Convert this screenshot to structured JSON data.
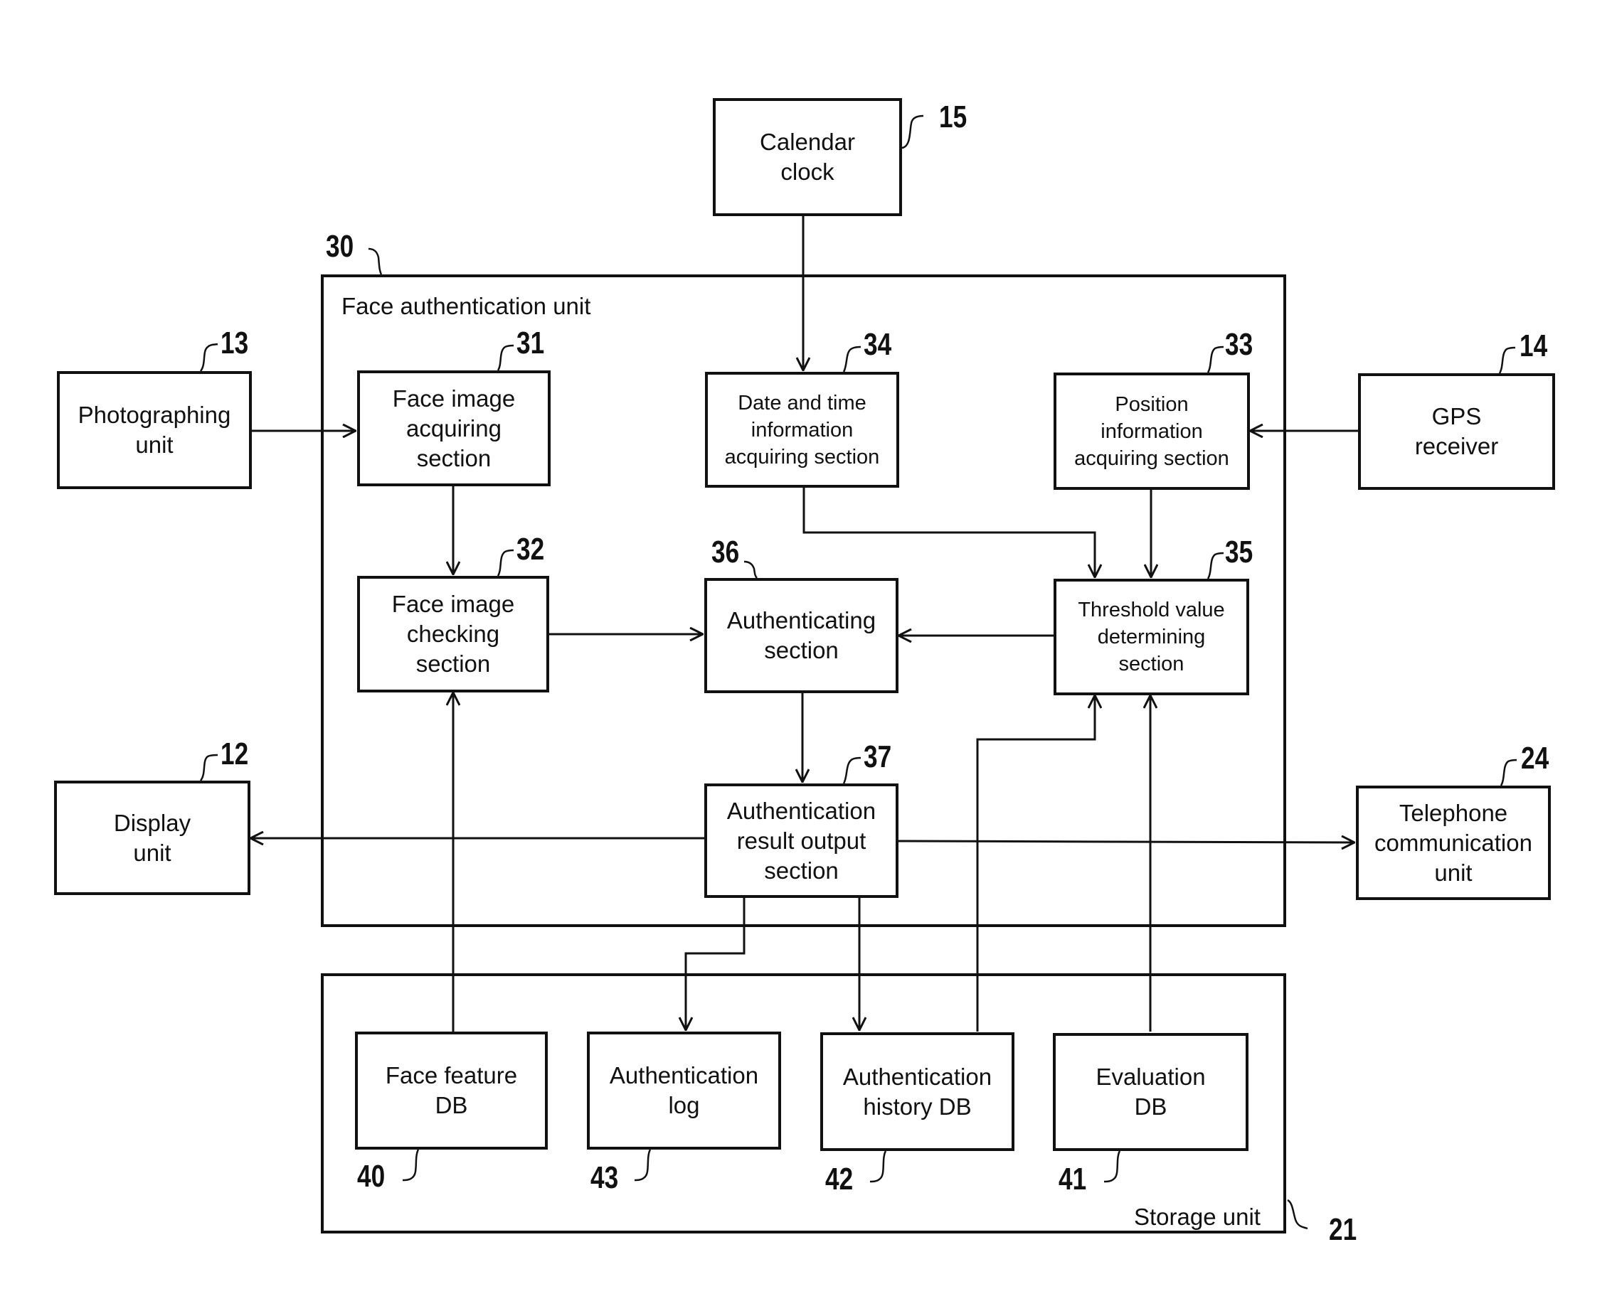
{
  "diagram": {
    "containers": {
      "face_auth": {
        "ref": "30",
        "label": "Face authentication unit"
      },
      "storage": {
        "ref": "21",
        "label": "Storage unit"
      }
    },
    "blocks": {
      "calendar": {
        "ref": "15",
        "label": "Calendar\nclock"
      },
      "photographing": {
        "ref": "13",
        "label": "Photographing\nunit"
      },
      "gps": {
        "ref": "14",
        "label": "GPS\nreceiver"
      },
      "display": {
        "ref": "12",
        "label": "Display\nunit"
      },
      "telephone": {
        "ref": "24",
        "label": "Telephone\ncommunication\nunit"
      },
      "face_acquire": {
        "ref": "31",
        "label": "Face image\nacquiring\nsection"
      },
      "face_check": {
        "ref": "32",
        "label": "Face image\nchecking\nsection"
      },
      "datetime": {
        "ref": "34",
        "label": "Date and time\ninformation\nacquiring section"
      },
      "position": {
        "ref": "33",
        "label": "Position\ninformation\nacquiring section"
      },
      "authenticating": {
        "ref": "36",
        "label": "Authenticating\nsection"
      },
      "threshold": {
        "ref": "35",
        "label": "Threshold value\ndetermining\nsection"
      },
      "result_output": {
        "ref": "37",
        "label": "Authentication\nresult output\nsection"
      },
      "face_feature_db": {
        "ref": "40",
        "label": "Face feature\nDB"
      },
      "auth_log": {
        "ref": "43",
        "label": "Authentication\nlog"
      },
      "auth_history_db": {
        "ref": "42",
        "label": "Authentication\nhistory DB"
      },
      "evaluation_db": {
        "ref": "41",
        "label": "Evaluation\nDB"
      }
    },
    "connections": [
      {
        "from": "calendar",
        "to": "datetime"
      },
      {
        "from": "photographing",
        "to": "face_acquire"
      },
      {
        "from": "gps",
        "to": "position"
      },
      {
        "from": "face_acquire",
        "to": "face_check"
      },
      {
        "from": "datetime",
        "to": "threshold"
      },
      {
        "from": "position",
        "to": "threshold"
      },
      {
        "from": "face_check",
        "to": "authenticating"
      },
      {
        "from": "threshold",
        "to": "authenticating"
      },
      {
        "from": "authenticating",
        "to": "result_output"
      },
      {
        "from": "result_output",
        "to": "display"
      },
      {
        "from": "result_output",
        "to": "telephone"
      },
      {
        "from": "result_output",
        "to": "auth_log"
      },
      {
        "from": "result_output",
        "to": "auth_history_db"
      },
      {
        "from": "face_feature_db",
        "to": "face_check"
      },
      {
        "from": "auth_history_db",
        "to": "threshold"
      },
      {
        "from": "evaluation_db",
        "to": "threshold"
      }
    ]
  }
}
